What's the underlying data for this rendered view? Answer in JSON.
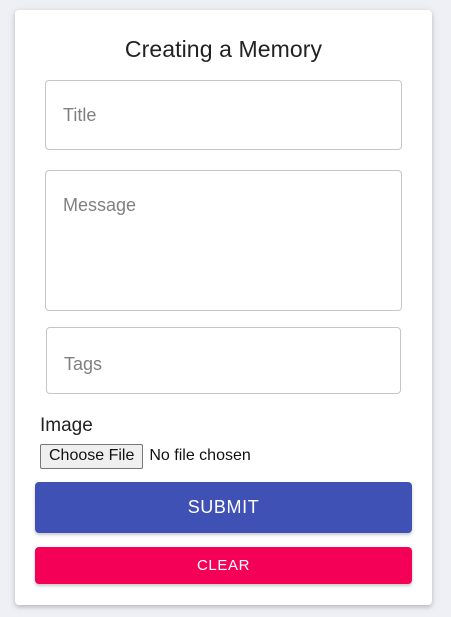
{
  "form": {
    "heading": "Creating a Memory",
    "title_placeholder": "Title",
    "message_placeholder": "Message",
    "tags_placeholder": "Tags",
    "image_label": "Image",
    "choose_file_label": "Choose File",
    "file_status": "No file chosen",
    "submit_label": "SUBMIT",
    "clear_label": "CLEAR"
  },
  "colors": {
    "submit": "#3f51b5",
    "clear": "#f50057"
  }
}
